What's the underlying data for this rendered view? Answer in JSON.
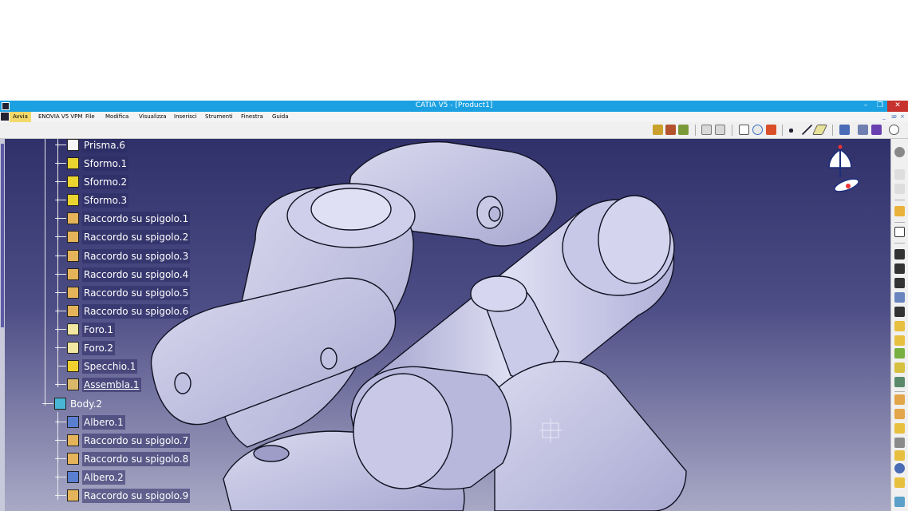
{
  "window": {
    "title": "CATIA V5 - [Product1]",
    "minimize": "–",
    "restore": "❐",
    "close": "✕"
  },
  "menu": {
    "avvia": "Avvia",
    "items": [
      "ENOVIA V5 VPM",
      "File",
      "Modifica",
      "Visualizza",
      "Inserisci",
      "Strumenti",
      "Finestra",
      "Guida"
    ],
    "mdi_controls": [
      "_",
      "ᴂ",
      "×"
    ]
  },
  "tree": {
    "nodes": [
      {
        "label": "Prisma.6",
        "icon": "prism-icon",
        "underline": false
      },
      {
        "label": "Sformo.1",
        "icon": "draft-icon",
        "underline": false
      },
      {
        "label": "Sformo.2",
        "icon": "draft-icon",
        "underline": false
      },
      {
        "label": "Sformo.3",
        "icon": "draft-icon",
        "underline": false
      },
      {
        "label": "Raccordo su spigolo.1",
        "icon": "edge-fillet-icon",
        "underline": false
      },
      {
        "label": "Raccordo su spigolo.2",
        "icon": "edge-fillet-icon",
        "underline": false
      },
      {
        "label": "Raccordo su spigolo.3",
        "icon": "edge-fillet-icon",
        "underline": false
      },
      {
        "label": "Raccordo su spigolo.4",
        "icon": "edge-fillet-icon",
        "underline": false
      },
      {
        "label": "Raccordo su spigolo.5",
        "icon": "edge-fillet-icon",
        "underline": false
      },
      {
        "label": "Raccordo su spigolo.6",
        "icon": "edge-fillet-icon",
        "underline": false
      },
      {
        "label": "Foro.1",
        "icon": "hole-icon",
        "underline": false
      },
      {
        "label": "Foro.2",
        "icon": "hole-icon",
        "underline": false
      },
      {
        "label": "Specchio.1",
        "icon": "mirror-icon",
        "underline": false
      },
      {
        "label": "Assembla.1",
        "icon": "assemble-icon",
        "underline": true
      },
      {
        "label": "Body.2",
        "icon": "body-icon",
        "underline": false
      },
      {
        "label": "Albero.1",
        "icon": "shaft-icon",
        "underline": false
      },
      {
        "label": "Raccordo su spigolo.7",
        "icon": "edge-fillet-icon",
        "underline": false
      },
      {
        "label": "Raccordo su spigolo.8",
        "icon": "edge-fillet-icon",
        "underline": false
      },
      {
        "label": "Albero.2",
        "icon": "shaft-icon",
        "underline": false
      },
      {
        "label": "Raccordo su spigolo.9",
        "icon": "edge-fillet-icon",
        "underline": false
      }
    ]
  },
  "colors": {
    "titlebar": "#1ba1e2",
    "viewport_top": "#30306a",
    "viewport_bottom": "#a9a9c6",
    "part_fill": "#c4c4e2",
    "part_edge": "#111122",
    "close_button": "#c7312e"
  }
}
